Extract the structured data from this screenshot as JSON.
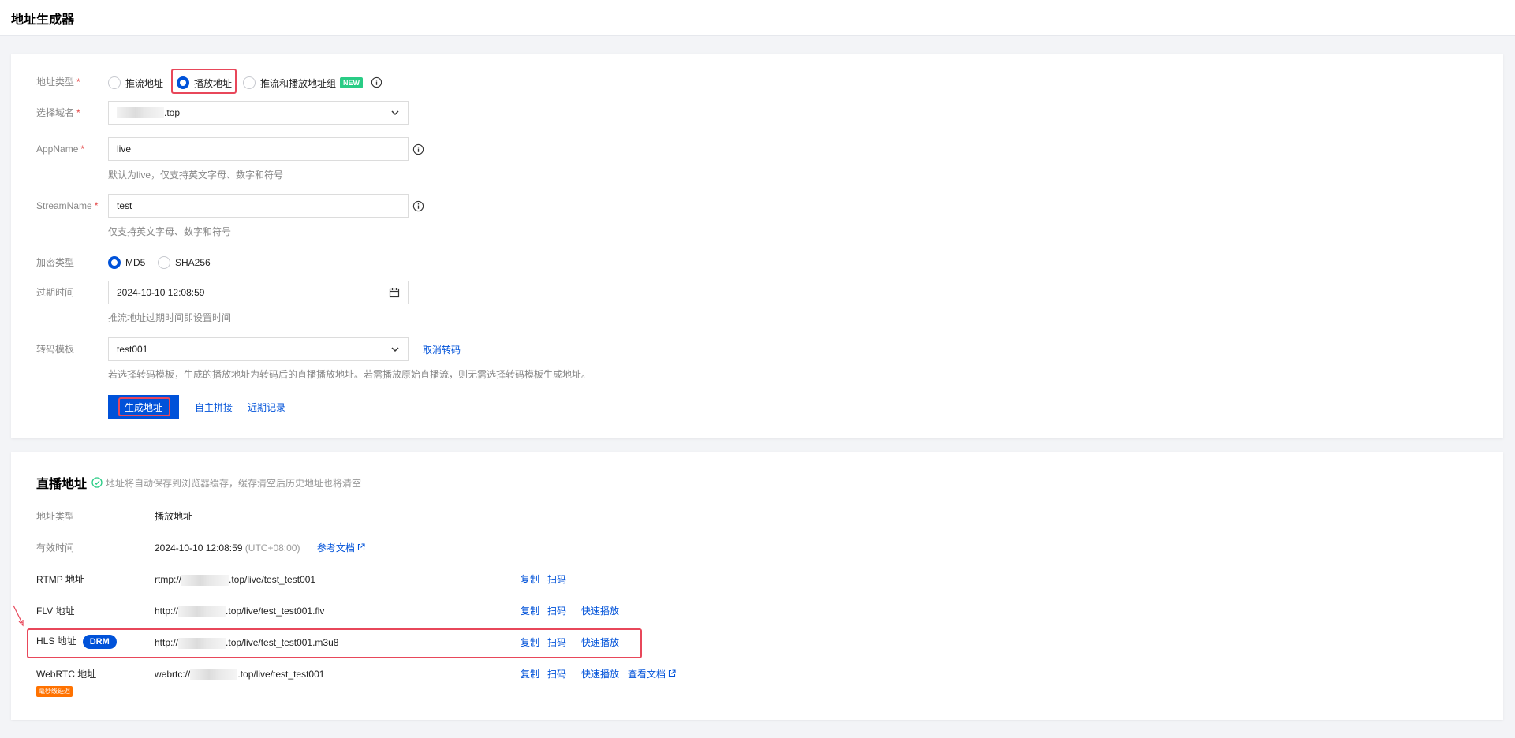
{
  "page": {
    "title": "地址生成器"
  },
  "form": {
    "address_type": {
      "label": "地址类型",
      "options": [
        "推流地址",
        "播放地址",
        "推流和播放地址组"
      ],
      "selected": "播放地址",
      "new_badge": "NEW"
    },
    "domain": {
      "label": "选择域名",
      "value_suffix": ".top"
    },
    "app_name": {
      "label": "AppName",
      "value": "live",
      "help": "默认为live，仅支持英文字母、数字和符号"
    },
    "stream_name": {
      "label": "StreamName",
      "value": "test",
      "help": "仅支持英文字母、数字和符号"
    },
    "encryption": {
      "label": "加密类型",
      "options": [
        "MD5",
        "SHA256"
      ],
      "selected": "MD5"
    },
    "expire": {
      "label": "过期时间",
      "value": "2024-10-10 12:08:59",
      "help": "推流地址过期时间即设置时间"
    },
    "transcode": {
      "label": "转码模板",
      "value": "test001",
      "cancel_label": "取消转码",
      "help": "若选择转码模板，生成的播放地址为转码后的直播播放地址。若需播放原始直播流，则无需选择转码模板生成地址。"
    },
    "actions": {
      "generate": "生成地址",
      "custom": "自主拼接",
      "recent": "近期记录"
    }
  },
  "result": {
    "title": "直播地址",
    "note": "地址将自动保存到浏览器缓存，缓存清空后历史地址也将清空",
    "type_label": "地址类型",
    "type_value": "播放地址",
    "valid_label": "有效时间",
    "valid_value": "2024-10-10 12:08:59",
    "valid_tz": "(UTC+08:00)",
    "docs_label": "参考文档",
    "rows": [
      {
        "label": "RTMP 地址",
        "prefix": "rtmp://",
        "suffix": ".top/live/test_test001",
        "actions": [
          "复制",
          "扫码"
        ]
      },
      {
        "label": "FLV 地址",
        "prefix": "http://",
        "suffix": ".top/live/test_test001.flv",
        "actions": [
          "复制",
          "扫码",
          "快速播放"
        ]
      },
      {
        "label": "HLS 地址",
        "badge": "DRM",
        "prefix": "http://",
        "suffix": ".top/live/test_test001.m3u8",
        "actions": [
          "复制",
          "扫码",
          "快速播放"
        ]
      },
      {
        "label": "WebRTC 地址",
        "badge": "毫秒级延迟",
        "prefix": "webrtc://",
        "suffix": ".top/live/test_test001",
        "actions": [
          "复制",
          "扫码",
          "快速播放",
          "查看文档"
        ]
      }
    ]
  },
  "colors": {
    "primary": "#0052d9",
    "highlight": "#e8475a",
    "new_badge": "#29cc85",
    "ull_badge": "#ff7200"
  }
}
